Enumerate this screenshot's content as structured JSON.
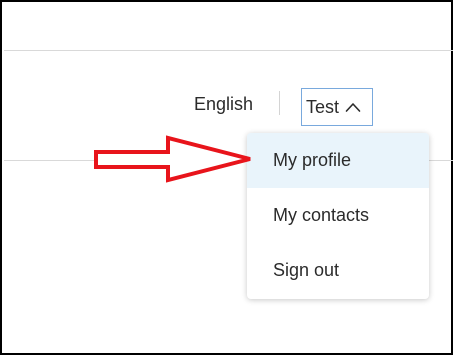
{
  "header": {
    "language_label": "English",
    "user_button_label": "Test"
  },
  "user_menu": {
    "items": [
      {
        "label": "My profile",
        "highlighted": true
      },
      {
        "label": "My contacts",
        "highlighted": false
      },
      {
        "label": "Sign out",
        "highlighted": false
      }
    ]
  },
  "colors": {
    "annotation_arrow": "#e8141b",
    "menu_highlight": "#e9f4fb",
    "user_button_border": "#79a9dd",
    "text": "#2b2b2b"
  },
  "icons": {
    "user_button": "chevron-up-icon",
    "annotation": "red-arrow-pointer"
  }
}
